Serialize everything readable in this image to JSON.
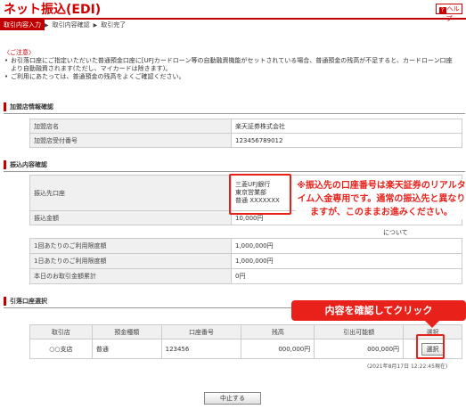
{
  "header": {
    "title": "ネット振込(EDI)",
    "help_label": "ヘルプ"
  },
  "steps": [
    "取引内容入力",
    "取引内容確認",
    "取引完了"
  ],
  "notice": {
    "heading": "〈ご注意〉",
    "lines": [
      "お引落口座にご指定いただいた普通預金口座に[UFJカードローン等の自動融資機能がセットされている場合、普通預金の残高が不足すると、カードローン口座より自動融資されます(ただし、マイカードは除きます)。",
      "ご利用にあたっては、普通預金の残高をよくご確認ください。"
    ]
  },
  "merchant": {
    "section": "加盟店情報確認",
    "rows": [
      {
        "label": "加盟店名",
        "value": "楽天証券株式会社"
      },
      {
        "label": "加盟店受付番号",
        "value": "123456789012"
      }
    ]
  },
  "transfer": {
    "section": "振込内容確認",
    "dest_label": "振込先口座",
    "dest_lines": [
      "三菱UFJ銀行",
      "東京営業部",
      "普通 XXXXXXX"
    ],
    "amount_label": "振込金額",
    "amount_value": "10,000円"
  },
  "limits": [
    {
      "label": "1回あたりのご利用限度額",
      "value": "1,000,000円"
    },
    {
      "label": "1日あたりのご利用限度額",
      "value": "1,000,000円"
    },
    {
      "label": "本日のお取引金額累計",
      "value": "0円"
    }
  ],
  "account": {
    "section": "引落口座選択",
    "headers": [
      "取引店",
      "預金種類",
      "口座番号",
      "残高",
      "引出可能額",
      "選択"
    ],
    "row": {
      "branch": "○○支店",
      "type": "普通",
      "number": "123456",
      "balance": "000,000円",
      "available": "000,000円",
      "select_label": "選択"
    },
    "timestamp": "(2021年8月17日 12:22:45現在)"
  },
  "stop_label": "中止する",
  "annotations": {
    "note": "※振込先の口座番号は楽天証券のリアルタイム入金専用です。通常の振込先と異なりますが、このままお進みください。",
    "note_overflow": "について",
    "callout": "内容を確認してクリック"
  },
  "colors": {
    "brand_red": "#c00000",
    "annotation_red": "#e8221b"
  }
}
